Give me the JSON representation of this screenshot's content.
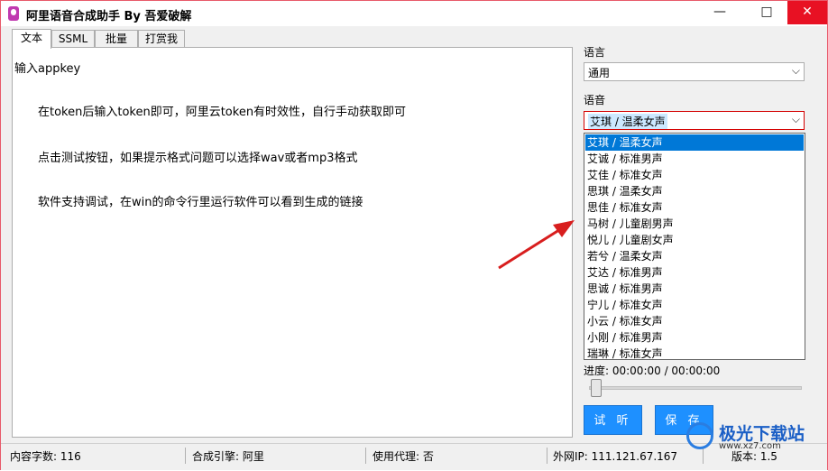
{
  "window": {
    "title": "阿里语音合成助手 By 吾爱破解"
  },
  "title_controls": {
    "minimize": "—",
    "maximize": "□",
    "close": "✕"
  },
  "tabs": [
    {
      "label": "文本"
    },
    {
      "label": "SSML"
    },
    {
      "label": "批量"
    },
    {
      "label": "打赏我"
    }
  ],
  "text_panel": {
    "lines": [
      "输入appkey",
      "在token后输入token即可，阿里云token有时效性，自行手动获取即可",
      "点击测试按钮，如果提示格式问题可以选择wav或者mp3格式",
      "软件支持调试，在win的命令行里运行软件可以看到生成的链接"
    ]
  },
  "language": {
    "label": "语言",
    "value": "通用"
  },
  "voice": {
    "label": "语音",
    "value": "艾琪 / 温柔女声",
    "options": [
      "艾琪 / 温柔女声",
      "艾诚 / 标准男声",
      "艾佳 / 标准女声",
      "思琪 / 温柔女声",
      "思佳 / 标准女声",
      "马树 / 儿童剧男声",
      "悦儿 / 儿童剧女声",
      "若兮 / 温柔女声",
      "艾达 / 标准男声",
      "思诚 / 标准男声",
      "宁儿 / 标准女声",
      "小云 / 标准女声",
      "小刚 / 标准男声",
      "瑞琳 / 标准女声"
    ],
    "selected_index": 0
  },
  "progress": {
    "text": "进度: 00:00:00 / 00:00:00",
    "fraction": 0
  },
  "buttons": {
    "listen": "试 听",
    "save": "保 存"
  },
  "status": {
    "char_count": "内容字数: 116",
    "engine": "合成引擎: 阿里",
    "proxy": "使用代理: 否",
    "ip": "外网IP: 111.121.67.167",
    "version": "版本: 1.5"
  },
  "watermark": {
    "text": "极光下载站",
    "url": "www.xz7.com"
  },
  "colors": {
    "accent": "#1e90ff",
    "selection": "#0078d7",
    "arrow": "#d81e1e",
    "close": "#e81123"
  }
}
